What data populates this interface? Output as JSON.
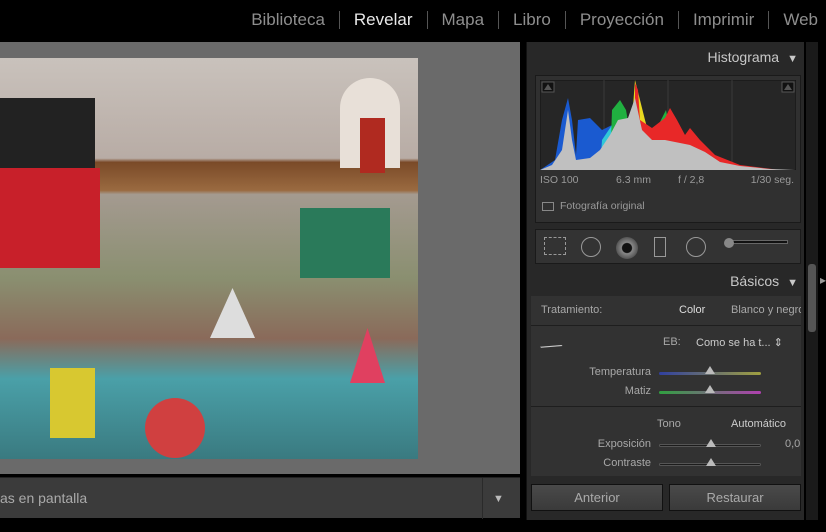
{
  "nav": {
    "items": [
      "Biblioteca",
      "Revelar",
      "Mapa",
      "Libro",
      "Proyección",
      "Imprimir",
      "Web"
    ],
    "active": "Revelar"
  },
  "toolbar": {
    "label": "as en pantalla"
  },
  "histogram": {
    "title": "Histograma",
    "iso": "ISO 100",
    "focal": "6.3 mm",
    "aperture": "f / 2,8",
    "shutter": "1/30 seg.",
    "original_label": "Fotografía original"
  },
  "basics": {
    "title": "Básicos",
    "treatment_label": "Tratamiento:",
    "color": "Color",
    "bw": "Blanco y negro",
    "wb_label": "EB:",
    "wb_value": "Como se ha t...",
    "temp": "Temperatura",
    "tint": "Matiz",
    "tone": "Tono",
    "auto": "Automático",
    "exposure": "Exposición",
    "exposure_value": "0,0",
    "contrast": "Contraste"
  },
  "buttons": {
    "previous": "Anterior",
    "reset": "Restaurar"
  }
}
